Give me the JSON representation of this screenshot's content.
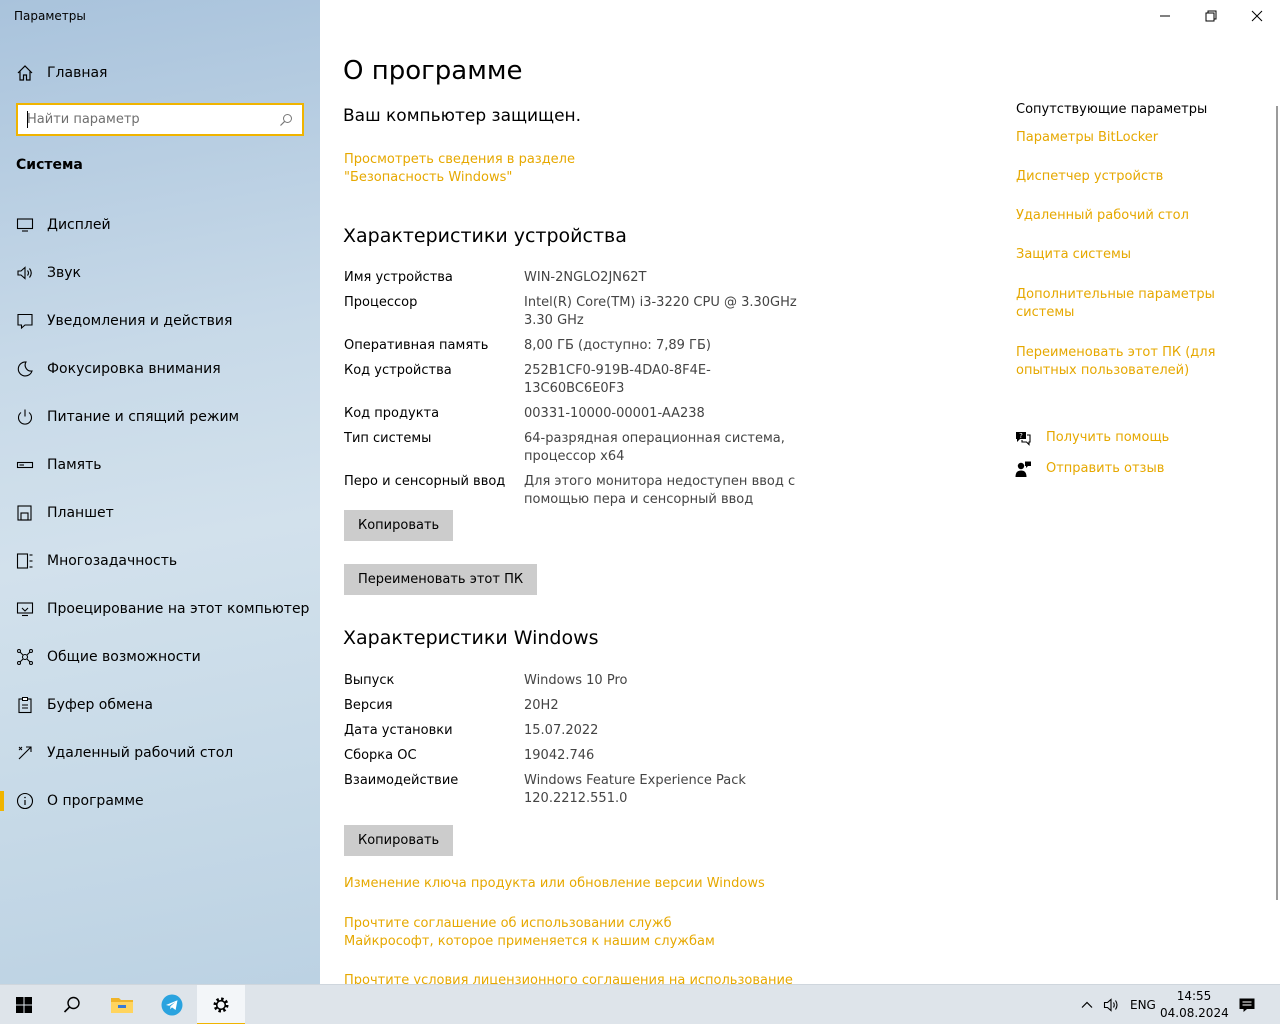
{
  "window": {
    "title": "Параметры",
    "minimize_glyph": "─",
    "maximize_glyph": "⧉",
    "close_glyph": "✕"
  },
  "sidebar": {
    "home_label": "Главная",
    "search_placeholder": "Найти параметр",
    "section_title": "Система",
    "items": [
      {
        "label": "Дисплей",
        "icon": "display-icon"
      },
      {
        "label": "Звук",
        "icon": "sound-icon"
      },
      {
        "label": "Уведомления и действия",
        "icon": "notifications-icon"
      },
      {
        "label": "Фокусировка внимания",
        "icon": "focus-assist-icon"
      },
      {
        "label": "Питание и спящий режим",
        "icon": "power-icon"
      },
      {
        "label": "Память",
        "icon": "storage-icon"
      },
      {
        "label": "Планшет",
        "icon": "tablet-icon"
      },
      {
        "label": "Многозадачность",
        "icon": "multitasking-icon"
      },
      {
        "label": "Проецирование на этот компьютер",
        "icon": "projecting-icon"
      },
      {
        "label": "Общие возможности",
        "icon": "shared-experiences-icon"
      },
      {
        "label": "Буфер обмена",
        "icon": "clipboard-icon"
      },
      {
        "label": "Удаленный рабочий стол",
        "icon": "remote-desktop-icon"
      },
      {
        "label": "О программе",
        "icon": "info-icon",
        "active": true
      }
    ]
  },
  "main": {
    "page_title": "О программе",
    "protected_text": "Ваш компьютер защищен.",
    "security_link": "Просмотреть сведения в разделе \"Безопасность Windows\"",
    "device_specs": {
      "heading": "Характеристики устройства",
      "rows": [
        {
          "key": "Имя устройства",
          "value": "WIN-2NGLO2JN62T"
        },
        {
          "key": "Процессор",
          "value": "Intel(R) Core(TM) i3-3220 CPU @ 3.30GHz 3.30 GHz"
        },
        {
          "key": "Оперативная память",
          "value": "8,00 ГБ (доступно: 7,89 ГБ)"
        },
        {
          "key": "Код устройства",
          "value": "252B1CF0-919B-4DA0-8F4E-13C60BC6E0F3"
        },
        {
          "key": "Код продукта",
          "value": "00331-10000-00001-AA238"
        },
        {
          "key": "Тип системы",
          "value": "64-разрядная операционная система, процессор x64"
        },
        {
          "key": "Перо и сенсорный ввод",
          "value": "Для этого монитора недоступен ввод с помощью пера и сенсорный ввод"
        }
      ],
      "copy_button": "Копировать",
      "rename_button": "Переименовать этот ПК"
    },
    "windows_specs": {
      "heading": "Характеристики Windows",
      "rows": [
        {
          "key": "Выпуск",
          "value": "Windows 10 Pro"
        },
        {
          "key": "Версия",
          "value": "20H2"
        },
        {
          "key": "Дата установки",
          "value": "15.07.2022"
        },
        {
          "key": "Сборка ОС",
          "value": "19042.746"
        },
        {
          "key": "Взаимодействие",
          "value": "Windows Feature Experience Pack 120.2212.551.0"
        }
      ],
      "copy_button": "Копировать"
    },
    "bottom_links": [
      "Изменение ключа продукта или обновление версии Windows",
      "Прочтите соглашение об использовании служб Майкрософт, которое применяется к нашим службам",
      "Прочтите условия лицензионного соглашения на использование"
    ]
  },
  "related": {
    "title": "Сопутствующие параметры",
    "links": [
      "Параметры BitLocker",
      "Диспетчер устройств",
      "Удаленный рабочий стол",
      "Защита системы",
      "Дополнительные параметры системы",
      "Переименовать этот ПК (для опытных пользователей)"
    ],
    "help_label": "Получить помощь",
    "feedback_label": "Отправить отзыв"
  },
  "taskbar": {
    "language": "ENG",
    "time": "14:55",
    "date": "04.08.2024"
  },
  "colors": {
    "accent": "#f0b400",
    "link": "#e6a800",
    "button_bg": "#cccccc"
  }
}
